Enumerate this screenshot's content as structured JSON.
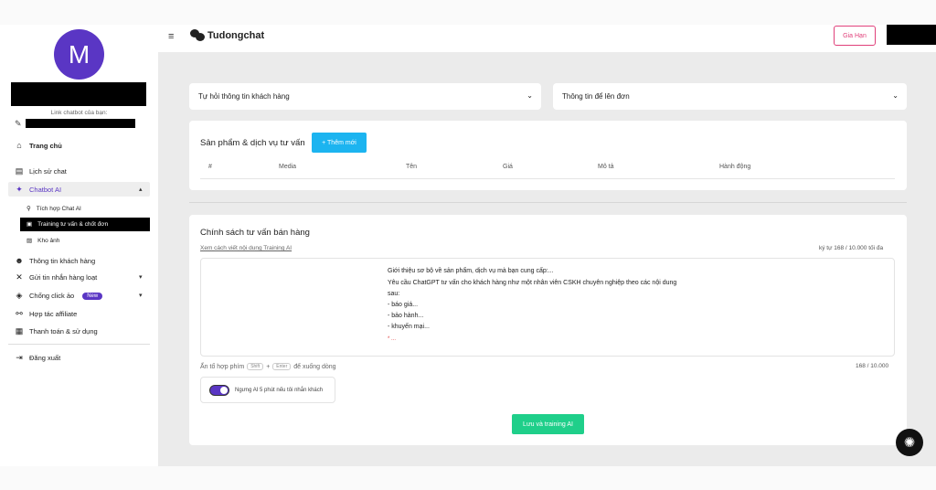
{
  "app": {
    "name": "Tudongchat",
    "renew_label": "Gia Hạn"
  },
  "profile": {
    "avatar_letter": "M",
    "chatbot_link_label": "Link chatbot của bạn:"
  },
  "sidebar": {
    "home": "Trang chủ",
    "chat_history": "Lịch sử chat",
    "chatbot_ai": "Chatbot AI",
    "sub_items": [
      "Tích hợp Chat AI",
      "Training tư vấn & chốt đơn",
      "Kho ảnh"
    ],
    "customer_info": "Thông tin khách hàng",
    "bulk_message": "Gửi tin nhắn hàng loạt",
    "anti_click": "Chống click ảo",
    "new_badge": "New",
    "affiliate": "Hợp tác affiliate",
    "billing": "Thanh toán & sử dụng",
    "logout": "Đăng xuất"
  },
  "selects": {
    "collect_info": "Tự hỏi thông tin khách hàng",
    "order_info": "Thông tin để lên đơn"
  },
  "products": {
    "title": "Sản phẩm & dịch vụ tư vấn",
    "add_label": "+ Thêm mới",
    "columns": [
      "#",
      "Media",
      "Tên",
      "Giá",
      "Mô tả",
      "Hành động"
    ]
  },
  "policy": {
    "title": "Chính sách tư vấn bán hàng",
    "guide_link": "Xem cách viết nội dung Training AI",
    "char_count": "ký tự 168 / 10.000 tối đa",
    "text_lines": [
      "Giới thiệu sơ bộ về sản phẩm, dịch vụ mà bạn cung cấp:...",
      "Yêu cầu ChatGPT tư vấn cho khách hàng như một nhân viên CSKH chuyên nghiệp theo các nội dung",
      "sau:",
      "- báo giá...",
      "- bảo hành...",
      "- khuyến mại..."
    ],
    "text_tail": "* ...",
    "hint_prefix": "Ấn tổ hợp phím",
    "hint_key1": "Shift",
    "hint_plus": "+",
    "hint_key2": "Enter",
    "hint_suffix": "để xuống dòng",
    "count_short": "168 / 10.000",
    "toggle_label": "Ngưng AI 5 phút nếu tôi nhắn khách",
    "toggle_on": true,
    "save_label": "Lưu và training AI"
  },
  "colors": {
    "accent": "#5a36c4",
    "add_button": "#1cb4f0",
    "save_button": "#1fcf8a",
    "renew_border": "#e0407a"
  }
}
